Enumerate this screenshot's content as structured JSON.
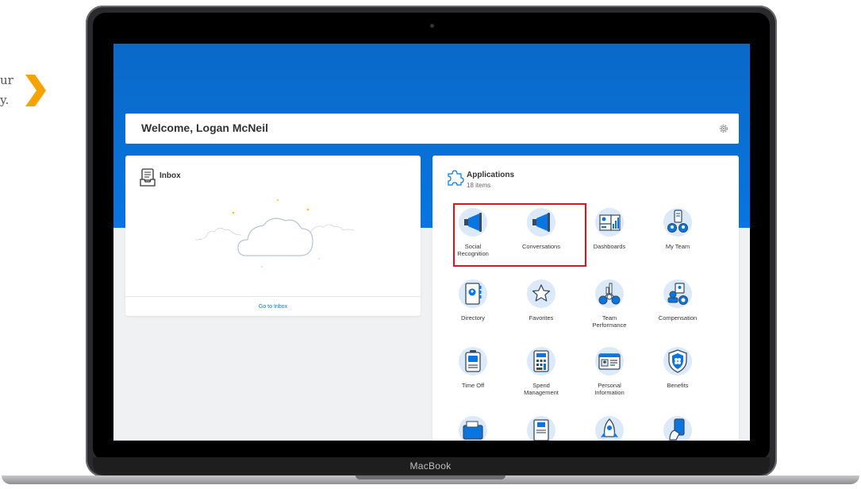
{
  "side_text": {
    "line1": "ur",
    "line2": "y."
  },
  "laptop": {
    "brand": "MacBook"
  },
  "welcome": {
    "title": "Welcome, Logan McNeil"
  },
  "inbox": {
    "title": "Inbox",
    "link": "Go to Inbox"
  },
  "applications": {
    "title": "Applications",
    "count": "18 items",
    "tiles": [
      {
        "label": "Social\nRecognition",
        "icon": "megaphone-icon"
      },
      {
        "label": "Conversations",
        "icon": "megaphone-icon"
      },
      {
        "label": "Dashboards",
        "icon": "dashboard-icon"
      },
      {
        "label": "My Team",
        "icon": "team-icon"
      },
      {
        "label": "Directory",
        "icon": "directory-icon"
      },
      {
        "label": "Favorites",
        "icon": "star-icon"
      },
      {
        "label": "Team\nPerformance",
        "icon": "team-performance-icon"
      },
      {
        "label": "Compensation",
        "icon": "compensation-icon"
      },
      {
        "label": "Time Off",
        "icon": "luggage-icon"
      },
      {
        "label": "Spend\nManagement",
        "icon": "calculator-icon"
      },
      {
        "label": "Personal\nInformation",
        "icon": "id-card-icon"
      },
      {
        "label": "Benefits",
        "icon": "shield-icon"
      }
    ]
  },
  "colors": {
    "brand_blue": "#0875e1",
    "highlight": "#e0131c",
    "chevron": "#f5a300"
  }
}
